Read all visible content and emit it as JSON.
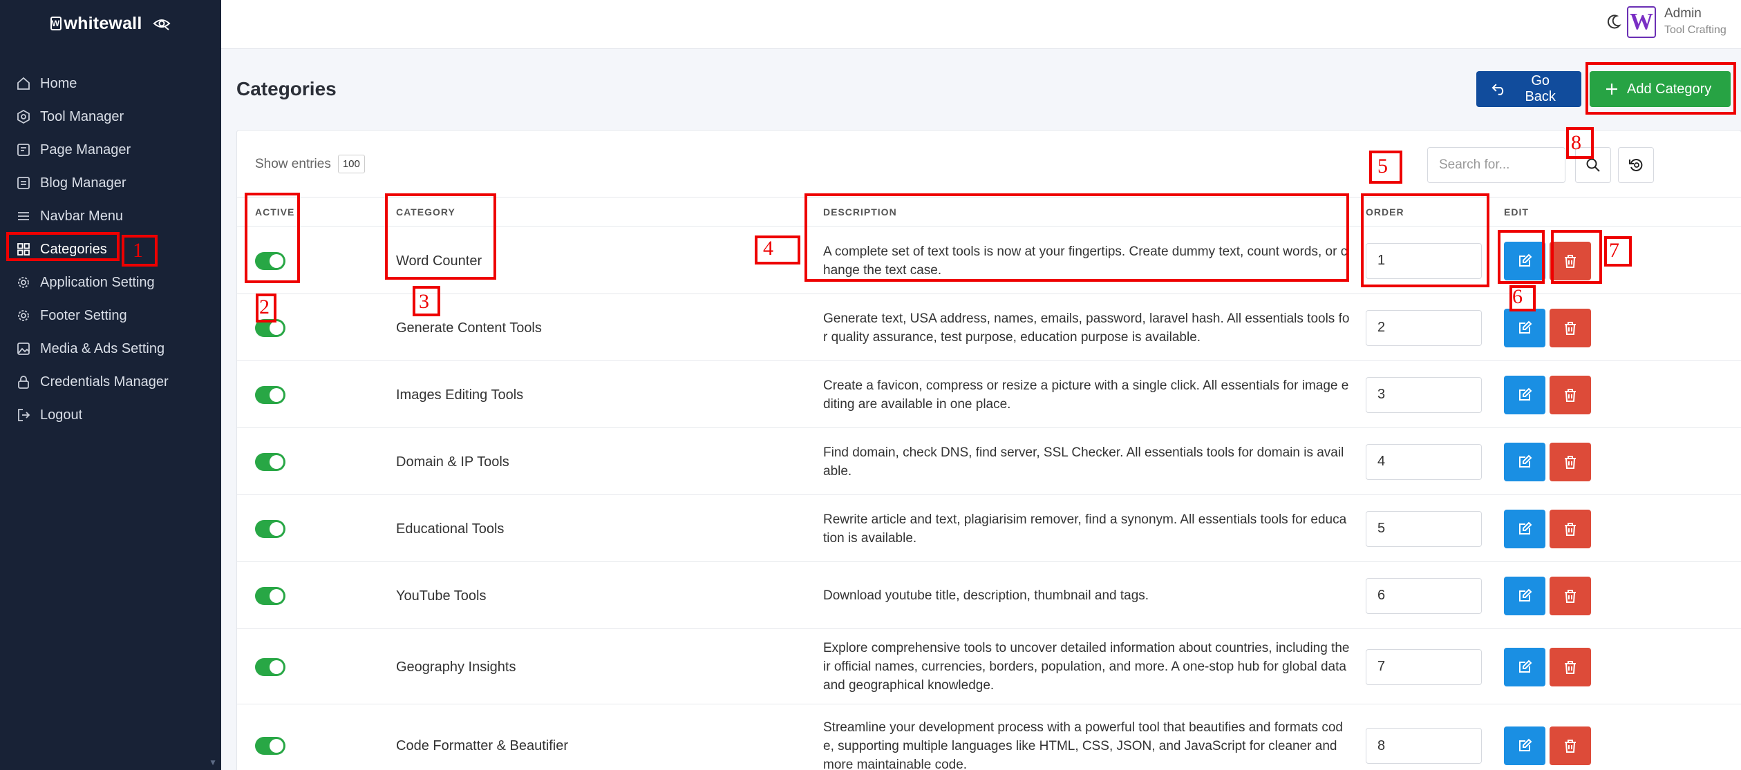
{
  "app": {
    "brand": "whitewall"
  },
  "sidebar": {
    "items": [
      {
        "label": "Home",
        "icon": "home-icon"
      },
      {
        "label": "Tool Manager",
        "icon": "gear-icon"
      },
      {
        "label": "Page Manager",
        "icon": "page-icon"
      },
      {
        "label": "Blog Manager",
        "icon": "blog-icon"
      },
      {
        "label": "Navbar Menu",
        "icon": "menu-icon"
      },
      {
        "label": "Categories",
        "icon": "grid-icon",
        "active": true
      },
      {
        "label": "Application Setting",
        "icon": "settings-icon"
      },
      {
        "label": "Footer Setting",
        "icon": "settings-icon"
      },
      {
        "label": "Media & Ads Setting",
        "icon": "image-icon"
      },
      {
        "label": "Credentials Manager",
        "icon": "lock-icon"
      },
      {
        "label": "Logout",
        "icon": "logout-icon"
      }
    ]
  },
  "header": {
    "user_name": "Admin",
    "user_role": "Tool Crafting",
    "avatar_letter": "W"
  },
  "page": {
    "title": "Categories",
    "go_back_label": "Go Back",
    "add_label": "Add Category"
  },
  "toolbar": {
    "show_entries_label": "Show entries",
    "entries_value": "100",
    "search_placeholder": "Search for..."
  },
  "table": {
    "headers": [
      "ACTIVE",
      "CATEGORY",
      "DESCRIPTION",
      "ORDER",
      "EDIT"
    ],
    "rows": [
      {
        "active": true,
        "category": "Word Counter",
        "description": "A complete set of text tools is now at your fingertips. Create dummy text, count words, or change the text case.",
        "order": "1"
      },
      {
        "active": true,
        "category": "Generate Content Tools",
        "description": "Generate text, USA address, names, emails, password, laravel hash. All essentials tools for quality assurance, test purpose, education purpose is available.",
        "order": "2"
      },
      {
        "active": true,
        "category": "Images Editing Tools",
        "description": "Create a favicon, compress or resize a picture with a single click. All essentials for image editing are available in one place.",
        "order": "3"
      },
      {
        "active": true,
        "category": "Domain & IP Tools",
        "description": "Find domain, check DNS, find server, SSL Checker. All essentials tools for domain is available.",
        "order": "4"
      },
      {
        "active": true,
        "category": "Educational Tools",
        "description": "Rewrite article and text, plagiarisim remover, find a synonym. All essentials tools for education is available.",
        "order": "5"
      },
      {
        "active": true,
        "category": "YouTube Tools",
        "description": "Download youtube title, description, thumbnail and tags.",
        "order": "6"
      },
      {
        "active": true,
        "category": "Geography Insights",
        "description": "Explore comprehensive tools to uncover detailed information about countries, including their official names, currencies, borders, population, and more. A one-stop hub for global data and geographical knowledge.",
        "order": "7"
      },
      {
        "active": true,
        "category": "Code Formatter & Beautifier",
        "description": "Streamline your development process with a powerful tool that beautifies and formats code, supporting multiple languages like HTML, CSS, JSON, and JavaScript for cleaner and more maintainable code.",
        "order": "8"
      }
    ]
  },
  "annotations": [
    "1",
    "2",
    "3",
    "4",
    "5",
    "6",
    "7",
    "8"
  ],
  "colors": {
    "sidebar_bg": "#182236",
    "go_back": "#114c9c",
    "add": "#27a344",
    "toggle_on": "#28a745",
    "edit": "#1a8fe3",
    "delete": "#dd4b39",
    "annotation": "#ee0000"
  }
}
